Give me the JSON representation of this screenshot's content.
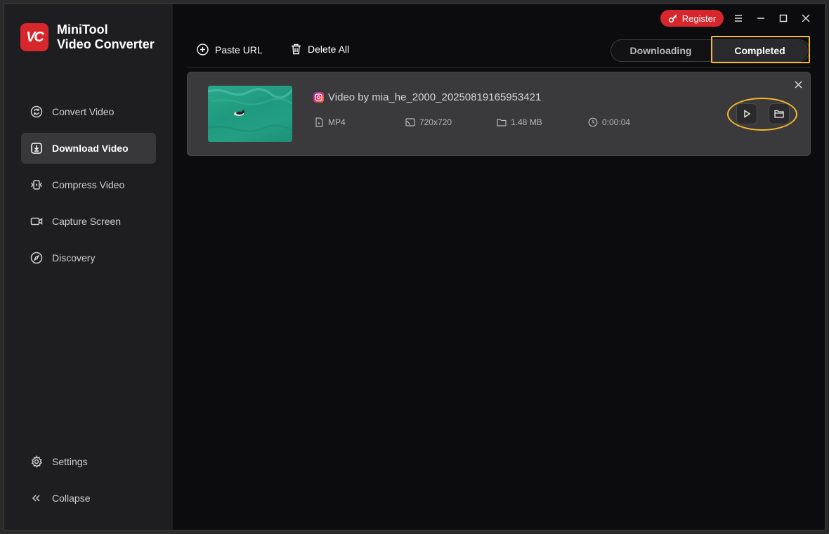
{
  "app": {
    "name_line1": "MiniTool",
    "name_line2": "Video Converter",
    "logo_text": "VC"
  },
  "sidebar": {
    "items": [
      {
        "label": "Convert Video",
        "icon": "convert-icon",
        "active": false
      },
      {
        "label": "Download Video",
        "icon": "download-icon",
        "active": true
      },
      {
        "label": "Compress Video",
        "icon": "compress-icon",
        "active": false
      },
      {
        "label": "Capture Screen",
        "icon": "camera-icon",
        "active": false
      },
      {
        "label": "Discovery",
        "icon": "compass-icon",
        "active": false
      }
    ],
    "bottom": [
      {
        "label": "Settings",
        "icon": "gear-icon"
      },
      {
        "label": "Collapse",
        "icon": "double-chevron-left-icon"
      }
    ]
  },
  "header": {
    "register_label": "Register"
  },
  "toolbar": {
    "paste_url_label": "Paste URL",
    "delete_all_label": "Delete All"
  },
  "tabs": {
    "downloading": "Downloading",
    "completed": "Completed",
    "selected": "Completed"
  },
  "downloads": [
    {
      "title": "Video by mia_he_2000_20250819165953421",
      "source_icon": "instagram-icon",
      "format": "MP4",
      "resolution": "720x720",
      "size": "1.48 MB",
      "duration": "0:00:04"
    }
  ],
  "colors": {
    "accent": "#d7262c",
    "highlight": "#f5b82e",
    "background": "#0c0c0e",
    "sidebar": "#1e1e20",
    "card": "#3a3a3c"
  }
}
